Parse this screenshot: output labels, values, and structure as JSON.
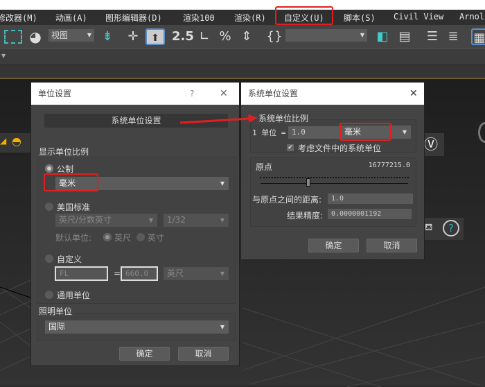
{
  "menubar": {
    "items": [
      "修改器(M)",
      "动画(A)",
      "图形编辑器(D)",
      "渲染100",
      "渲染(R)",
      "自定义(U)",
      "脚本(S)",
      "Civil View",
      "Arnol"
    ],
    "highlighted": "自定义(U)"
  },
  "toolbar": {
    "view_dropdown": "视图",
    "snap_label": "2.5",
    "percent": "%"
  },
  "units_dialog": {
    "title": "单位设置",
    "help": "?",
    "close": "✕",
    "system_button": "系统单位设置",
    "display_group": "显示单位比例",
    "metric_label": "公制",
    "metric_value": "毫米",
    "us_label": "美国标准",
    "us_value": "英尺/分数英寸",
    "us_fraction": "1/32",
    "default_unit_label": "默认单位:",
    "default_feet": "英尺",
    "default_inch": "英寸",
    "custom_label": "自定义",
    "custom_name": "FL",
    "equals": "=",
    "custom_value": "660.0",
    "custom_unit": "英尺",
    "generic_label": "通用单位",
    "lighting_group": "照明单位",
    "lighting_value": "国际",
    "ok": "确定",
    "cancel": "取消"
  },
  "system_dialog": {
    "title": "系统单位设置",
    "close": "✕",
    "scale_group": "系统单位比例",
    "unit_prefix": "1 单位 =",
    "unit_value": "1.0",
    "unit_type": "毫米",
    "respect_checkbox": "考虑文件中的系统单位",
    "respect_checked": true,
    "origin_label": "原点",
    "origin_value": "16777215.0",
    "distance_label": "与原点之间的距离:",
    "distance_value": "1.0",
    "precision_label": "结果精度:",
    "precision_value": "0.0000001192",
    "ok": "确定",
    "cancel": "取消"
  },
  "colors": {
    "highlight": "#e02020",
    "dialog_bg": "#444444"
  }
}
